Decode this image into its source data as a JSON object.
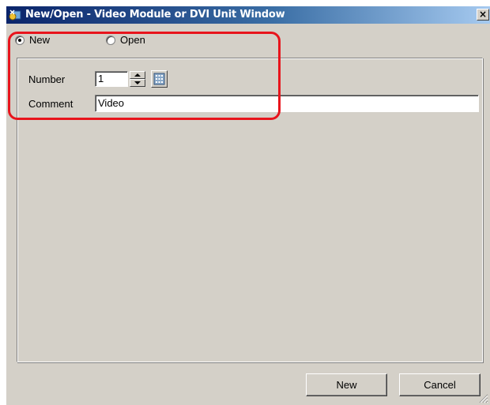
{
  "window": {
    "title": "New/Open - Video Module or DVI Unit Window",
    "close_label": "×"
  },
  "mode": {
    "new_label": "New",
    "open_label": "Open",
    "selected": "New"
  },
  "form": {
    "number_label": "Number",
    "number_value": "1",
    "comment_label": "Comment",
    "comment_value": "Video"
  },
  "buttons": {
    "new_label": "New",
    "cancel_label": "Cancel"
  },
  "icons": {
    "app": "app-window-icon",
    "keypad": "keypad-icon",
    "spin_up": "spin-up-arrow-icon",
    "spin_down": "spin-down-arrow-icon",
    "grip": "resize-grip-icon"
  },
  "colors": {
    "title_gradient_start": "#0a246a",
    "title_gradient_end": "#a6caf0",
    "face": "#d4d0c8",
    "highlight": "#e8141c"
  }
}
